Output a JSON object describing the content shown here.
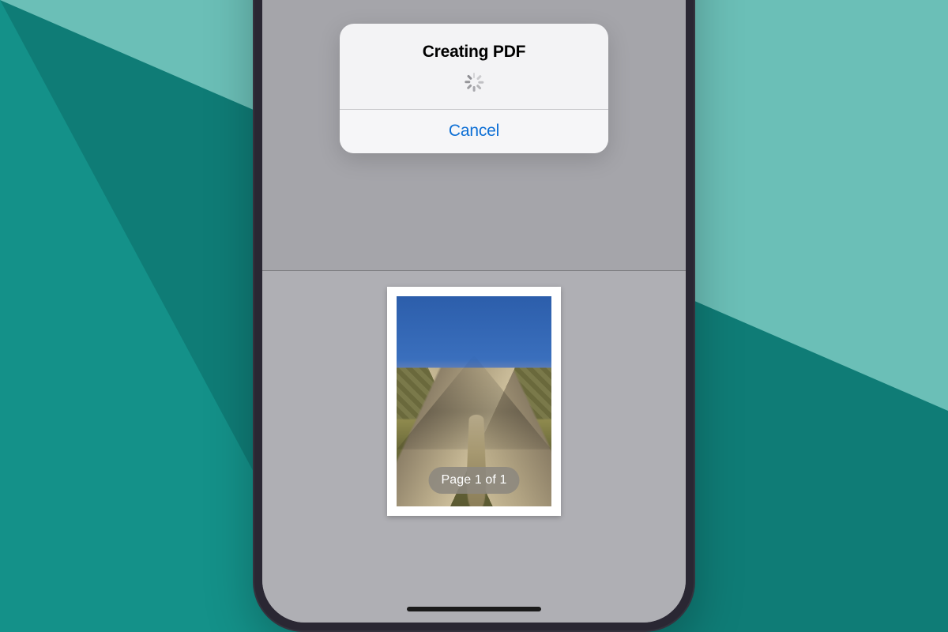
{
  "alert": {
    "title": "Creating PDF",
    "cancel_label": "Cancel"
  },
  "preview": {
    "page_badge": "Page 1 of 1"
  },
  "colors": {
    "ios_blue": "#0d6fd5",
    "bg_dark_teal": "#0f7c76",
    "bg_mid_teal": "#149189",
    "bg_light_teal": "#6bbfb7"
  }
}
